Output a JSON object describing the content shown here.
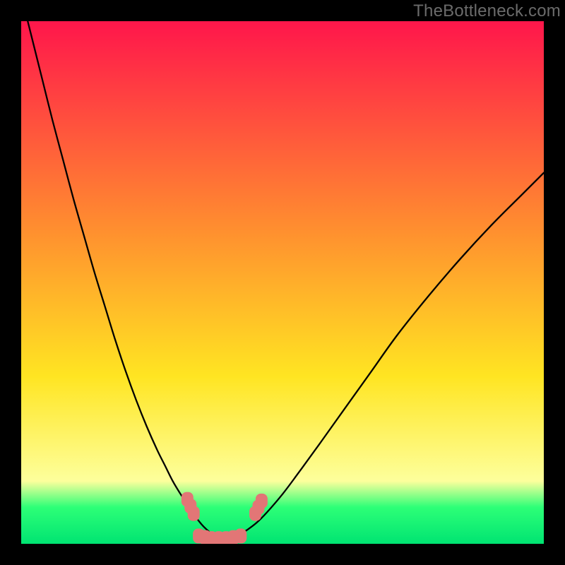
{
  "watermark": "TheBottleneck.com",
  "colors": {
    "frame": "#000000",
    "gradient_top": "#ff164b",
    "gradient_mid_upper": "#ff8f2f",
    "gradient_mid": "#ffe522",
    "gradient_lower_band_light": "#fdff9c",
    "gradient_green_top": "#2dff77",
    "gradient_green_bottom": "#00e472",
    "curve": "#000000",
    "marker_fill": "#e27676",
    "marker_stroke": "#e27676"
  },
  "chart_data": {
    "type": "line",
    "title": "",
    "xlabel": "",
    "ylabel": "",
    "xlim": [
      0,
      100
    ],
    "ylim": [
      0,
      100
    ],
    "series": [
      {
        "name": "left-curve",
        "x": [
          0,
          2,
          4,
          6,
          8,
          10,
          12,
          14,
          16,
          18,
          20,
          22,
          24,
          26,
          27.5,
          29,
          30.5,
          31.5,
          32.5,
          33.5,
          35,
          37,
          39
        ],
        "y": [
          105,
          97,
          89,
          81,
          73.5,
          66,
          59,
          52,
          45.5,
          39,
          33,
          27.5,
          22.5,
          18,
          15,
          12,
          9.5,
          8,
          6.5,
          5,
          3.2,
          1.5,
          0.5
        ]
      },
      {
        "name": "right-curve",
        "x": [
          39,
          41,
          43,
          45,
          47,
          50,
          53,
          57,
          62,
          67,
          72,
          78,
          84,
          90,
          96,
          100
        ],
        "y": [
          0.5,
          1.2,
          2.5,
          4,
          6,
          9.5,
          13.5,
          19,
          26,
          33,
          40,
          47.5,
          54.5,
          61,
          67,
          71
        ]
      }
    ],
    "markers": {
      "name": "bottleneck-points",
      "points": [
        {
          "x": 31.8,
          "y": 8.5
        },
        {
          "x": 32.4,
          "y": 7.2
        },
        {
          "x": 33.0,
          "y": 5.8
        },
        {
          "x": 34.0,
          "y": 1.5
        },
        {
          "x": 35.2,
          "y": 1.2
        },
        {
          "x": 36.4,
          "y": 1.0
        },
        {
          "x": 37.8,
          "y": 1.0
        },
        {
          "x": 39.2,
          "y": 1.0
        },
        {
          "x": 40.6,
          "y": 1.2
        },
        {
          "x": 42.0,
          "y": 1.5
        },
        {
          "x": 44.8,
          "y": 5.8
        },
        {
          "x": 45.4,
          "y": 7.0
        },
        {
          "x": 46.0,
          "y": 8.2
        }
      ]
    },
    "gradient_stops": [
      {
        "offset": 0.0,
        "color_key": "gradient_top"
      },
      {
        "offset": 0.4,
        "color_key": "gradient_mid_upper"
      },
      {
        "offset": 0.68,
        "color_key": "gradient_mid"
      },
      {
        "offset": 0.88,
        "color_key": "gradient_lower_band_light"
      },
      {
        "offset": 0.93,
        "color_key": "gradient_green_top"
      },
      {
        "offset": 1.0,
        "color_key": "gradient_green_bottom"
      }
    ]
  }
}
